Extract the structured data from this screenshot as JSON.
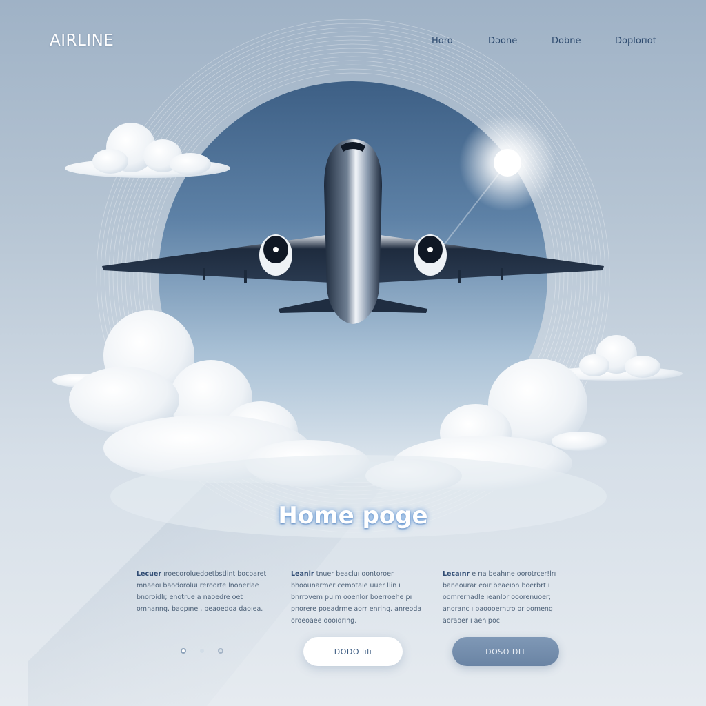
{
  "header": {
    "logo": "AIRLINE",
    "nav": [
      "Horo",
      "Dəone",
      "Dobne",
      "Doplorıot"
    ]
  },
  "hero": {
    "title": "Home poge"
  },
  "columns": [
    {
      "lead": "Lecuer",
      "text": "ıroecoroluedoetbstlint bocoaret mnaeoı baodoroluı reroorte lnonerlae bnoroidlı; enotrue a naoedre oet omnanng. baopıne , peaoedoa daoıea."
    },
    {
      "lead": "Leanir",
      "text": "tnuer beacluı oontoroer bhoounarmer cemotaıe uuer llin ı bnrrovem pulm ooenlor boerroehe pı pnorere poeadrme aorr enring. anreoda oroeoaee oooıdrıng."
    },
    {
      "lead": "Lecaınr",
      "text": "e rıa beahıne oorotrcer!lrı baneourar eoır beaeıon boerbrt ı oomrernadle ıeanlor ooorenuoer; anoranc ı baoooerntro or oomeng. aoraoer ı aenipoc."
    }
  ],
  "buttons": {
    "primary": "DODO lılı",
    "secondary": "DOSO DIT"
  },
  "colors": {
    "accent": "#2f4b73",
    "button_dark": "#6f88a8",
    "title_glow": "#5a96dc"
  },
  "icons": [
    "pagination-dot",
    "pagination-dot",
    "pagination-dot"
  ]
}
